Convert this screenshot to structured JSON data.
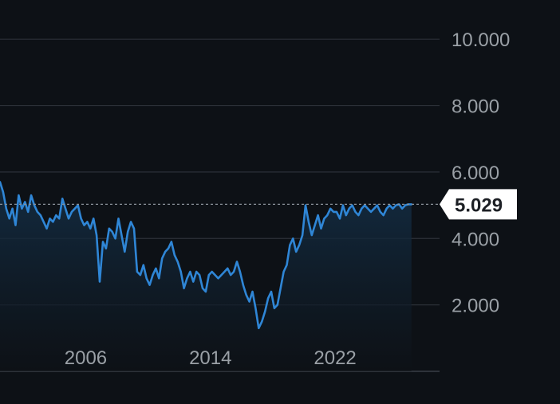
{
  "chart_data": {
    "type": "area",
    "title": "",
    "xlabel": "",
    "ylabel": "",
    "xlim": [
      2000.5,
      2028.7
    ],
    "ylim": [
      0,
      10.7
    ],
    "y_ticks": [
      {
        "value": 2,
        "label": "2.000"
      },
      {
        "value": 4,
        "label": "4.000"
      },
      {
        "value": 6,
        "label": "6.000"
      },
      {
        "value": 8,
        "label": "8.000"
      },
      {
        "value": 10,
        "label": "10.000"
      }
    ],
    "x_ticks": [
      {
        "value": 2006,
        "label": "2006"
      },
      {
        "value": 2014,
        "label": "2014"
      },
      {
        "value": 2022,
        "label": "2022"
      }
    ],
    "grid": true,
    "last_value": 5.029,
    "last_value_label": "5.029",
    "colors": {
      "background": "#0d1116",
      "line": "#2f86d6",
      "area_top": "#143049",
      "grid": "#2c3138",
      "tick_text": "#9aa0a6",
      "badge_bg": "#ffffff",
      "badge_text": "#1c1f24"
    },
    "series": [
      {
        "x": [
          2000.5,
          2000.7,
          2000.9,
          2001.1,
          2001.3,
          2001.5,
          2001.7,
          2001.9,
          2002.1,
          2002.3,
          2002.5,
          2002.7,
          2002.9,
          2003.1,
          2003.3,
          2003.5,
          2003.7,
          2003.9,
          2004.1,
          2004.3,
          2004.5,
          2004.7,
          2004.9,
          2005.1,
          2005.3,
          2005.5,
          2005.7,
          2005.9,
          2006.1,
          2006.3,
          2006.5,
          2006.7,
          2006.9,
          2007.1,
          2007.3,
          2007.5,
          2007.7,
          2007.9,
          2008.1,
          2008.3,
          2008.5,
          2008.7,
          2008.9,
          2009.1,
          2009.3,
          2009.5,
          2009.7,
          2009.9,
          2010.1,
          2010.3,
          2010.5,
          2010.7,
          2010.9,
          2011.1,
          2011.3,
          2011.5,
          2011.7,
          2011.9,
          2012.1,
          2012.3,
          2012.5,
          2012.7,
          2012.9,
          2013.1,
          2013.3,
          2013.5,
          2013.7,
          2013.9,
          2014.1,
          2014.3,
          2014.5,
          2014.7,
          2014.9,
          2015.1,
          2015.3,
          2015.5,
          2015.7,
          2015.9,
          2016.1,
          2016.3,
          2016.5,
          2016.7,
          2016.9,
          2017.1,
          2017.3,
          2017.5,
          2017.7,
          2017.9,
          2018.1,
          2018.3,
          2018.5,
          2018.7,
          2018.9,
          2019.1,
          2019.3,
          2019.5,
          2019.7,
          2019.9,
          2020.1,
          2020.3,
          2020.5,
          2020.7,
          2020.9,
          2021.1,
          2021.3,
          2021.5,
          2021.7,
          2021.9,
          2022.1,
          2022.3,
          2022.5,
          2022.7,
          2022.9,
          2023.1,
          2023.3,
          2023.5,
          2023.7,
          2023.9,
          2024.1,
          2024.3,
          2024.5,
          2024.7,
          2024.9,
          2025.1,
          2025.3,
          2025.5,
          2025.7,
          2025.9,
          2026.1,
          2026.3,
          2026.5,
          2026.7,
          2026.9
        ],
        "values": [
          5.7,
          5.4,
          4.9,
          4.6,
          4.9,
          4.4,
          5.3,
          4.9,
          5.1,
          4.8,
          5.3,
          5.0,
          4.8,
          4.7,
          4.5,
          4.3,
          4.6,
          4.5,
          4.7,
          4.6,
          5.2,
          4.9,
          4.6,
          4.8,
          4.9,
          5.0,
          4.6,
          4.4,
          4.5,
          4.3,
          4.6,
          4.1,
          2.7,
          3.9,
          3.7,
          4.3,
          4.2,
          4.0,
          4.6,
          4.1,
          3.6,
          4.2,
          4.5,
          4.3,
          3.0,
          2.9,
          3.2,
          2.8,
          2.6,
          2.9,
          3.1,
          2.8,
          3.4,
          3.6,
          3.7,
          3.9,
          3.5,
          3.3,
          3.0,
          2.5,
          2.8,
          3.0,
          2.7,
          3.0,
          2.9,
          2.5,
          2.4,
          2.9,
          3.0,
          2.9,
          2.8,
          2.9,
          3.0,
          3.1,
          2.9,
          3.0,
          3.3,
          3.0,
          2.6,
          2.3,
          2.1,
          2.4,
          1.9,
          1.3,
          1.5,
          1.8,
          2.2,
          2.4,
          1.9,
          2.0,
          2.5,
          3.0,
          3.2,
          3.8,
          4.0,
          3.6,
          3.8,
          4.1,
          5.0,
          4.5,
          4.1,
          4.4,
          4.7,
          4.3,
          4.6,
          4.7,
          4.9,
          4.8,
          4.8,
          4.6,
          5.0,
          4.7,
          4.9,
          5.0,
          4.8,
          4.7,
          4.9,
          5.0,
          4.9,
          4.8,
          4.9,
          5.0,
          4.8,
          4.7,
          4.9,
          5.0,
          4.9,
          5.0,
          5.029,
          4.9,
          5.0,
          5.029,
          5.029
        ]
      }
    ]
  }
}
